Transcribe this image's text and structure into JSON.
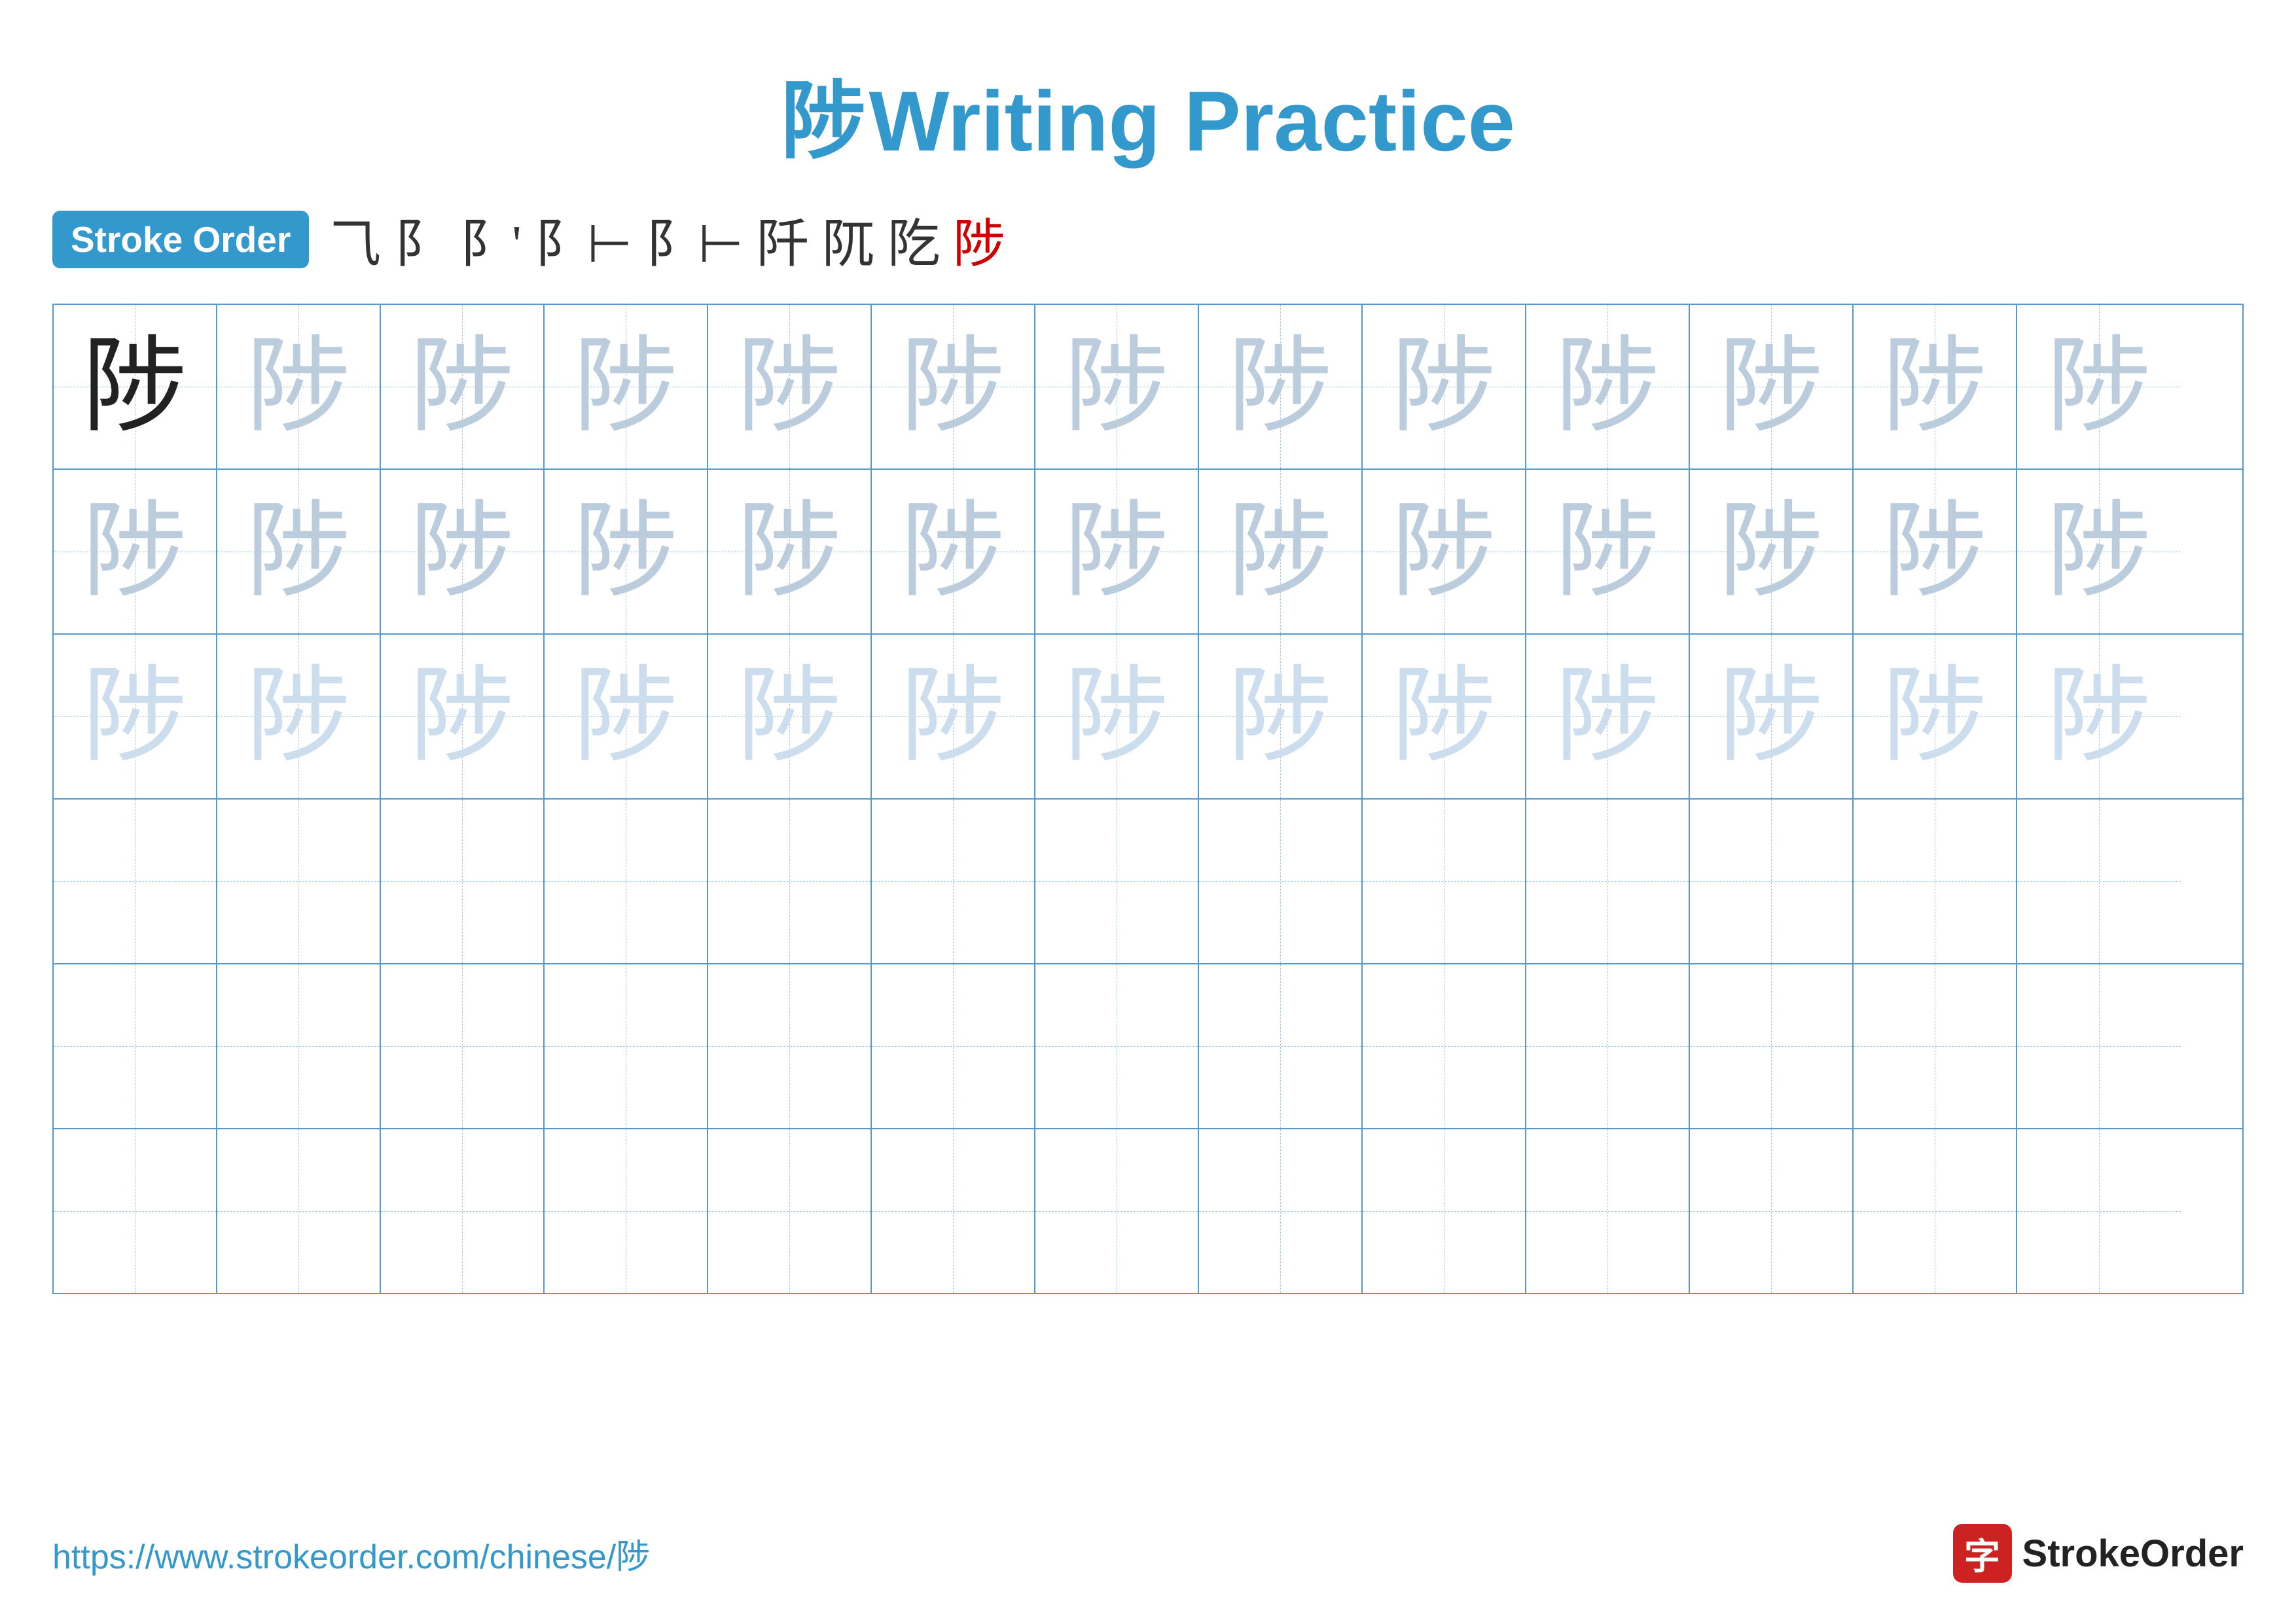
{
  "title": {
    "char": "陟",
    "label": "Writing Practice"
  },
  "stroke_order": {
    "badge_label": "Stroke Order",
    "steps": [
      "⺄",
      "阝",
      "阝'",
      "阝⊢",
      "阝⊢",
      "阝⺄⊢",
      "阝⺄⊢",
      "阝⺄陟",
      "陟"
    ]
  },
  "grid": {
    "rows": 6,
    "cols": 13,
    "char": "陟"
  },
  "footer": {
    "url": "https://www.strokeorder.com/chinese/陟",
    "logo_char": "字",
    "logo_text": "StrokeOrder"
  }
}
